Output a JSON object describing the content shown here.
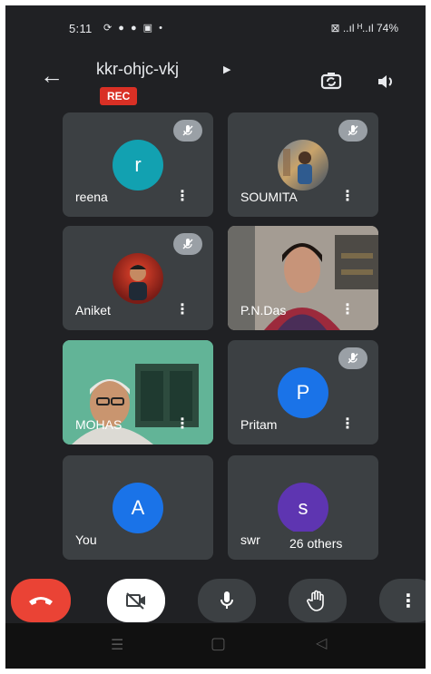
{
  "status": {
    "time": "5:11",
    "left_icons": "⟳ ● ● ▣ •",
    "right": "⊠ ..ıl ᴴ..ıl 74%"
  },
  "meeting": {
    "code": "kkr-ohjc-vkj",
    "rec_label": "REC"
  },
  "tiles": [
    {
      "name": "reena",
      "initial": "r",
      "color": "#12a1b1",
      "muted": true,
      "type": "avatar"
    },
    {
      "name": "SOUMITA",
      "muted": true,
      "type": "photo"
    },
    {
      "name": "Aniket",
      "muted": true,
      "type": "photo"
    },
    {
      "name": "P.N.Das",
      "muted": false,
      "type": "video"
    },
    {
      "name": "MOHAS",
      "muted": false,
      "type": "video"
    },
    {
      "name": "Pritam",
      "initial": "P",
      "color": "#1a73e8",
      "muted": true,
      "type": "avatar"
    },
    {
      "name": "You",
      "initial": "A",
      "color": "#1a73e8",
      "muted": false,
      "type": "avatar"
    },
    {
      "name": "swr",
      "initial": "s",
      "color": "#5e35b1",
      "muted": false,
      "type": "avatar",
      "others_label": "26 others"
    }
  ],
  "controls": [
    {
      "name": "end-call",
      "color": "#ea4335"
    },
    {
      "name": "camera-off",
      "color": "#ffffff"
    },
    {
      "name": "microphone",
      "color": "#3c4043"
    },
    {
      "name": "raise-hand",
      "color": "#3c4043"
    },
    {
      "name": "more-options",
      "color": "#3c4043"
    }
  ],
  "icons": [
    "back-arrow-icon",
    "switch-camera-icon",
    "speaker-icon",
    "mic-off-icon",
    "more-vert-icon",
    "end-call-icon",
    "video-off-icon",
    "mic-icon",
    "hand-icon"
  ]
}
